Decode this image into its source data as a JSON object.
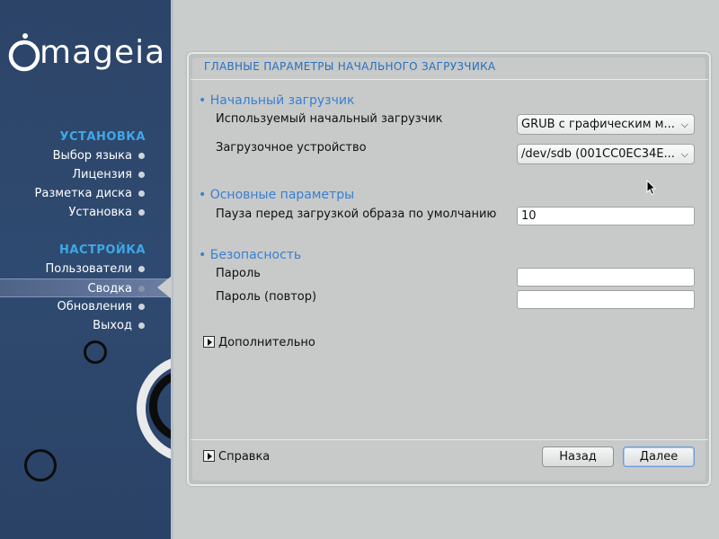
{
  "brand": {
    "logo_text": "mageia"
  },
  "sidebar": {
    "sections": [
      {
        "title": "УСТАНОВКА",
        "items": [
          {
            "label": "Выбор языка"
          },
          {
            "label": "Лицензия"
          },
          {
            "label": "Разметка диска"
          },
          {
            "label": "Установка"
          }
        ]
      },
      {
        "title": "НАСТРОЙКА",
        "items": [
          {
            "label": "Пользователи"
          },
          {
            "label": "Сводка"
          },
          {
            "label": "Обновления"
          },
          {
            "label": "Выход"
          }
        ]
      }
    ],
    "active_item": "Сводка"
  },
  "dialog": {
    "title": "ГЛАВНЫЕ ПАРАМЕТРЫ НАЧАЛЬНОГО ЗАГРУЗЧИКА",
    "groups": {
      "bootloader": {
        "heading": "• Начальный загрузчик",
        "bootloader_label": "Используемый начальный загрузчик",
        "bootloader_value": "GRUB с графическим м...",
        "device_label": "Загрузочное устройство",
        "device_value": "/dev/sdb (001CC0EC34E..."
      },
      "main": {
        "heading": "• Основные параметры",
        "delay_label": "Пауза перед загрузкой образа по умолчанию",
        "delay_value": "10"
      },
      "security": {
        "heading": "• Безопасность",
        "password_label": "Пароль",
        "password_value": "",
        "password_repeat_label": "Пароль (повтор)",
        "password_repeat_value": ""
      }
    },
    "advanced_label": "Дополнительно",
    "help_label": "Справка",
    "back_label": "Назад",
    "next_label": "Далее"
  },
  "icons": {
    "chevron": "chevron-down-icon",
    "expander": "expander-arrow-icon",
    "cursor": "mouse-pointer-icon"
  },
  "colors": {
    "sidebar_bg": "#2c4468",
    "section_title": "#3ea8e8",
    "dialog_title": "#2a6fc0",
    "group_heading": "#3a7fd0",
    "window_bg": "#c9cdcb"
  }
}
